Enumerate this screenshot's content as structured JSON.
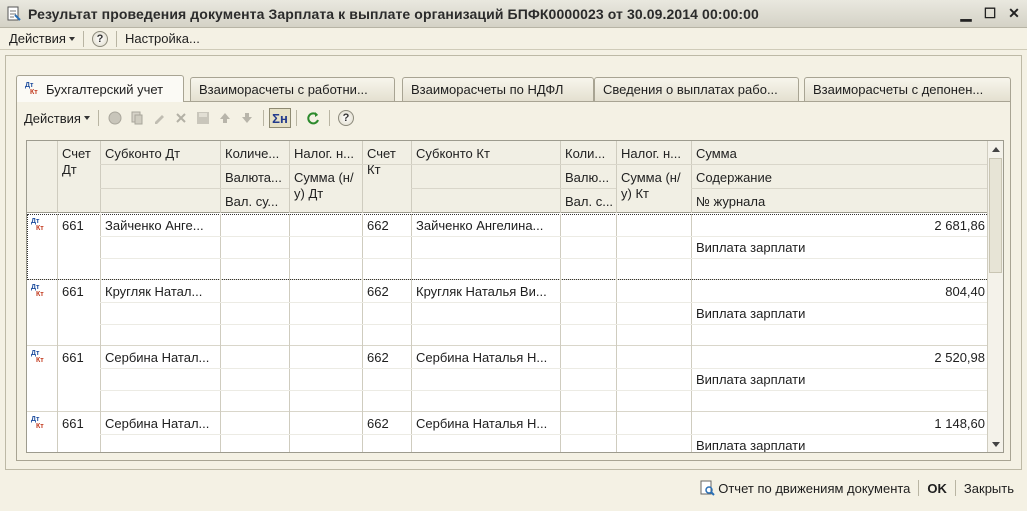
{
  "window": {
    "title": "Результат проведения документа Зарплата к выплате организаций БПФК0000023 от 30.09.2014 00:00:00",
    "minimize": "▁",
    "maximize": "☐",
    "close": "✕"
  },
  "menubar": {
    "actions_label": "Действия",
    "help_label": "?",
    "settings_label": "Настройка..."
  },
  "tabs": [
    {
      "label": "Бухгалтерский учет",
      "active": true
    },
    {
      "label": "Взаиморасчеты с работни..."
    },
    {
      "label": "Взаиморасчеты по НДФЛ"
    },
    {
      "label": "Сведения о выплатах рабо..."
    },
    {
      "label": "Взаиморасчеты с депонен..."
    }
  ],
  "tab_icon_glyphs": {
    "dt": "Дт",
    "kt": "Кт"
  },
  "toolbar": {
    "actions_label": "Действия",
    "help_label": "?",
    "sigma_label": "Σн"
  },
  "grid": {
    "headers": {
      "schet_dt": "Счет Дт",
      "subkonto_dt": "Субконто Дт",
      "kolich": "Количе...",
      "valuta": "Валюта...",
      "val_su": "Вал. су...",
      "nalog_n": "Налог. н...",
      "summa_nu_dt": "Сумма (н/у) Дт",
      "schet_kt": "Счет Кт",
      "subkonto_kt": "Субконто Кт",
      "koli": "Коли...",
      "valyu": "Валю...",
      "val_s": "Вал. с...",
      "nalog_n2": "Налог. н...",
      "summa_nu_kt": "Сумма (н/у) Кт",
      "summa": "Сумма",
      "soderzhanie": "Содержание",
      "nomer_zhurnala": "№ журнала"
    },
    "rows": [
      {
        "schet_dt": "661",
        "subkonto_dt": "Зайченко Анге...",
        "schet_kt": "662",
        "subkonto_kt": "Зайченко Ангелина...",
        "summa": "2 681,86",
        "soderzhanie": "Виплата зарплати",
        "selected": true
      },
      {
        "schet_dt": "661",
        "subkonto_dt": "Кругляк Натал...",
        "schet_kt": "662",
        "subkonto_kt": "Кругляк Наталья Ви...",
        "summa": "804,40",
        "soderzhanie": "Виплата зарплати"
      },
      {
        "schet_dt": "661",
        "subkonto_dt": "Сербина Натал...",
        "schet_kt": "662",
        "subkonto_kt": "Сербина Наталья Н...",
        "summa": "2 520,98",
        "soderzhanie": "Виплата зарплати"
      },
      {
        "schet_dt": "661",
        "subkonto_dt": "Сербина Натал...",
        "schet_kt": "662",
        "subkonto_kt": "Сербина Наталья Н...",
        "summa": "1 148,60",
        "soderzhanie": "Виплата зарплати"
      }
    ]
  },
  "bottom": {
    "report_label": "Отчет по движениям документа",
    "ok_label": "OK",
    "close_label": "Закрыть"
  }
}
